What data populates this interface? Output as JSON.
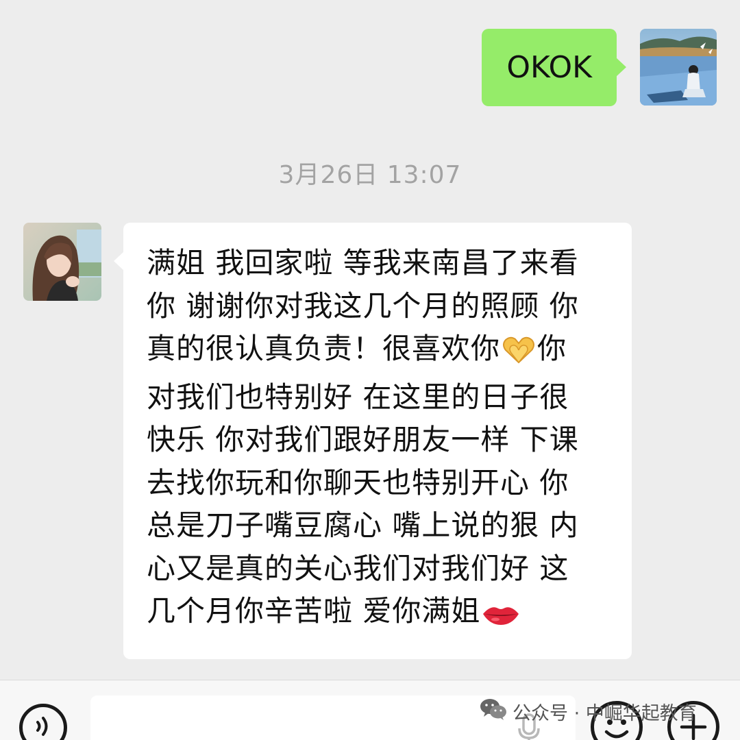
{
  "messages": {
    "outgoing": {
      "text": "OKOK"
    },
    "timestamp": "3月26日 13:07",
    "incoming": {
      "lines": [
        "满姐 我回家啦 等我来南昌了来看",
        "你 谢谢你对我这几个月的照顾 你",
        "真的很认真负责！很喜欢你",
        "你",
        "对我们也特别好 在这里的日子很",
        "快乐 你对我们跟好朋友一样 下课",
        "去找你玩和你聊天也特别开心 你",
        "总是刀子嘴豆腐心 嘴上说的狠 内",
        "心又是真的关心我们对我们好 这",
        "几个月你辛苦啦 爱你满姐"
      ],
      "emojis": [
        "heart-hands-emoji",
        "lips-emoji"
      ]
    }
  },
  "input_bar": {
    "icons": [
      "voice-icon",
      "microphone-icon",
      "emoji-face-icon",
      "plus-icon"
    ]
  },
  "watermark": {
    "text": "公众号 · 中崛华起教育"
  },
  "colors": {
    "background": "#ededed",
    "outgoing_bubble": "#95ec69",
    "incoming_bubble": "#ffffff",
    "timestamp": "#a3a3a3"
  }
}
